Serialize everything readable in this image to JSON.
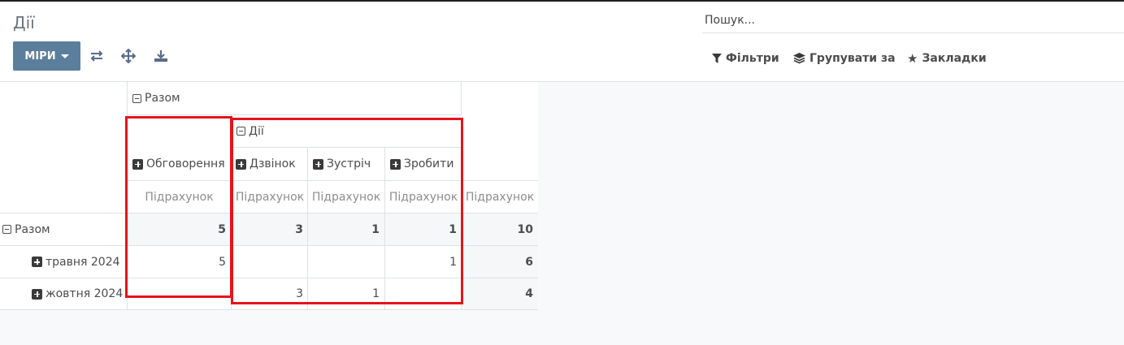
{
  "page": {
    "title": "Дії"
  },
  "toolbar": {
    "measures_label": "МІРИ",
    "flip_icon": "flip-axis-icon",
    "expand_icon": "expand-all-icon",
    "download_icon": "download-icon"
  },
  "search": {
    "placeholder": "Пошук..."
  },
  "filters": {
    "filters_label": "Фільтри",
    "group_by_label": "Групувати за",
    "favorites_label": "Закладки"
  },
  "pivot": {
    "col_total_header": "Разом",
    "col_group_actions": "Дії",
    "col_discussion": "Обговорення",
    "col_call": "Дзвінок",
    "col_meeting": "Зустріч",
    "col_todo": "Зробити",
    "measure_label": "Підрахунок",
    "rows": [
      {
        "label": "Разом",
        "discussion": "5",
        "call": "3",
        "meeting": "1",
        "todo": "1",
        "total": "10"
      },
      {
        "label": "травня 2024",
        "discussion": "5",
        "call": "",
        "meeting": "",
        "todo": "1",
        "total": "6"
      },
      {
        "label": "жовтня 2024",
        "discussion": "",
        "call": "3",
        "meeting": "1",
        "todo": "",
        "total": "4"
      }
    ]
  },
  "colors": {
    "primary": "#5b7e9c",
    "highlight": "#e8121b"
  }
}
